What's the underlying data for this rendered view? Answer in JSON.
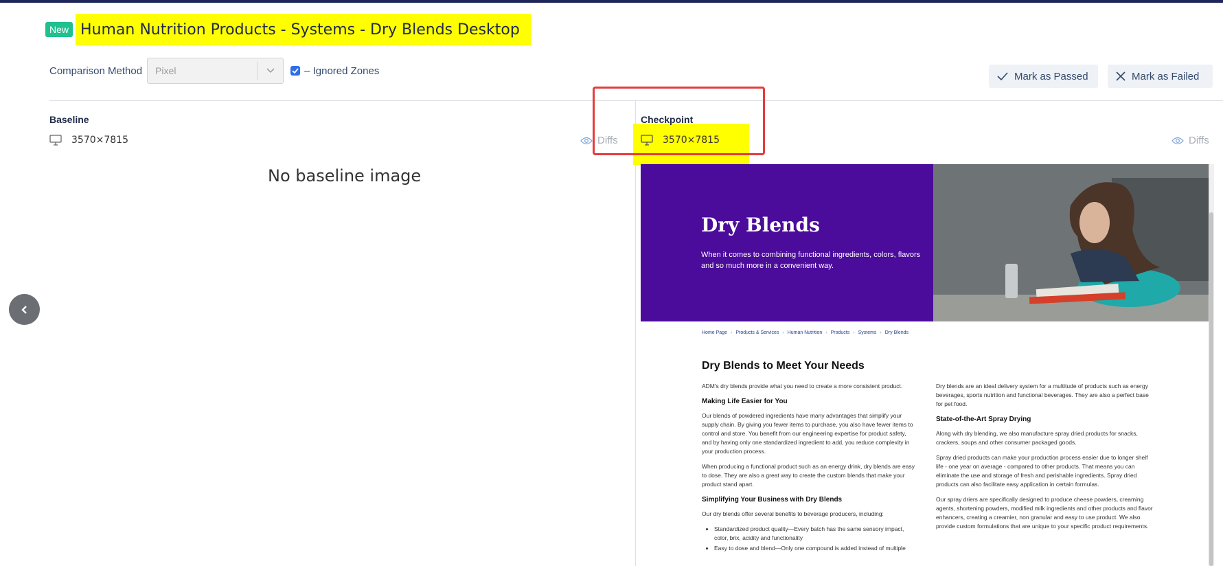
{
  "header": {
    "badge": "New",
    "title": "Human Nutrition Products - Systems - Dry Blends Desktop"
  },
  "controls": {
    "comparison_label": "Comparison Method",
    "comparison_value": "Pixel",
    "ignored_zones_label": "– Ignored Zones",
    "ignored_zones_checked": true
  },
  "actions": {
    "mark_passed": "Mark as Passed",
    "mark_failed": "Mark as Failed"
  },
  "baseline": {
    "title": "Baseline",
    "dimensions": "3570×7815",
    "diffs": "Diffs",
    "empty_message": "No baseline image"
  },
  "checkpoint": {
    "title": "Checkpoint",
    "dimensions": "3570×7815",
    "diffs": "Diffs"
  },
  "screenshot": {
    "hero_title": "Dry Blends",
    "hero_subtitle": "When it comes to combining functional ingredients, colors, flavors and so much more in a convenient way.",
    "breadcrumbs": [
      "Home Page",
      "Products & Services",
      "Human Nutrition",
      "Products",
      "Systems",
      "Dry Blends"
    ],
    "heading": "Dry Blends to Meet Your Needs",
    "left": {
      "p1": "ADM's dry blends provide what you need to create a more consistent product.",
      "h1": "Making Life Easier for You",
      "p2": "Our blends of powdered ingredients have many advantages that simplify your supply chain. By giving you fewer items to purchase, you also have fewer items to control and store. You benefit from our engineering expertise for product safety, and by having only one standardized ingredient to add, you reduce complexity in your production process.",
      "p3": "When producing a functional product such as an energy drink, dry blends are easy to dose. They are also a great way to create the custom blends that make your product stand apart.",
      "h2": "Simplifying Your Business with Dry Blends",
      "p4": "Our dry blends offer several benefits to beverage producers, including:",
      "li1": "Standardized product quality—Every batch has the same sensory impact, color, brix, acidity and functionality",
      "li2": "Easy to dose and blend—Only one compound is added instead of multiple"
    },
    "right": {
      "p1": "Dry blends are an ideal delivery system for a multitude of products such as energy beverages, sports nutrition and functional beverages. They are also a perfect base for pet food.",
      "h1": "State-of-the-Art Spray Drying",
      "p2": "Along with dry blending, we also manufacture spray dried products for snacks, crackers, soups and other consumer packaged goods.",
      "p3": "Spray dried products can make your production process easier due to longer shelf life - one year on average - compared to other products. That means you can eliminate the use and storage of fresh and perishable ingredients. Spray dried products can also facilitate easy application in certain formulas.",
      "p4": "Our spray driers are specifically designed to produce cheese powders, creaming agents, shortening powders, modified milk ingredients and other products and flavor enhancers, creating a creamier, non granular and easy to use product. We also provide custom formulations that are unique to your specific product requirements."
    }
  },
  "colors": {
    "badge": "#20c08f",
    "highlight": "#ffff00",
    "annotation": "#e43b3b",
    "hero": "#4b0b9b",
    "checkbox": "#2f6fe4"
  }
}
